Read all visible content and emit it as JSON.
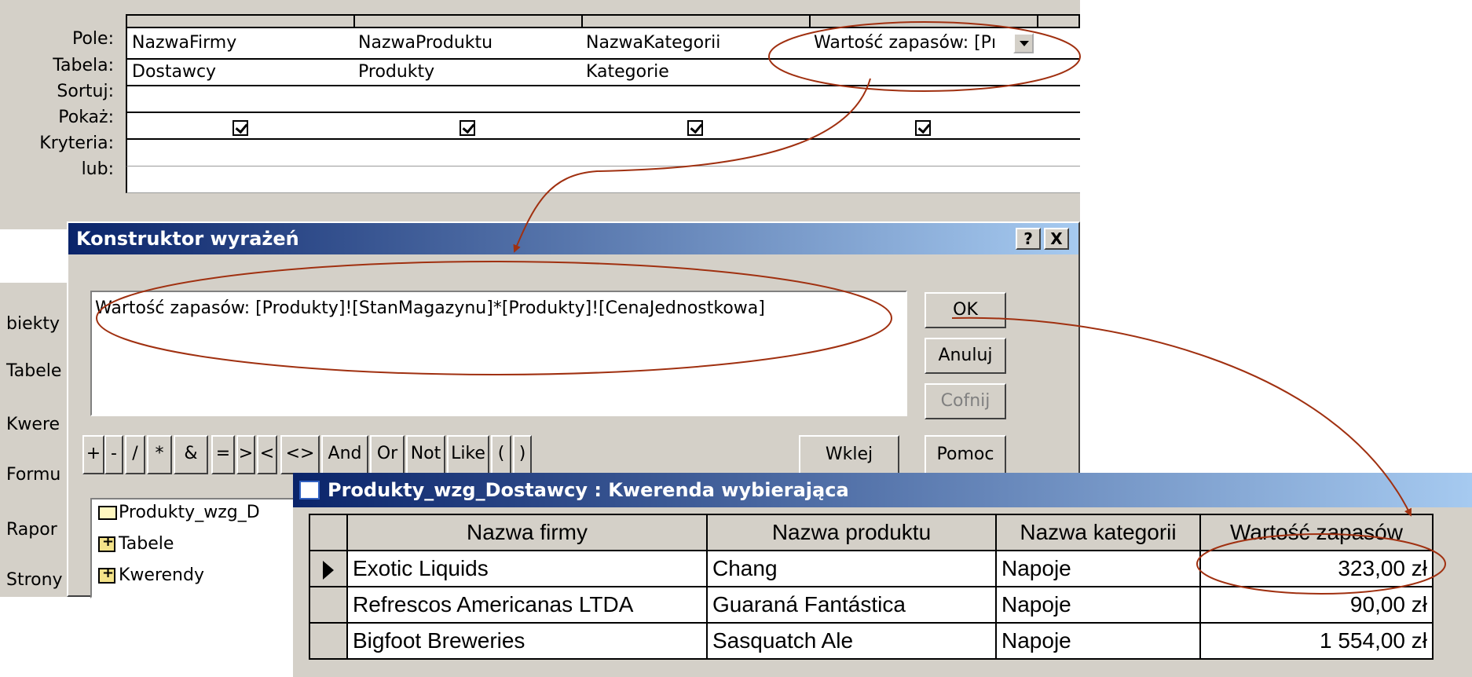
{
  "qbe": {
    "row_labels": [
      "Pole:",
      "Tabela:",
      "Sortuj:",
      "Pokaż:",
      "Kryteria:",
      "lub:"
    ],
    "columns": [
      {
        "field": "NazwaFirmy",
        "table": "Dostawcy",
        "show": true
      },
      {
        "field": "NazwaProduktu",
        "table": "Produkty",
        "show": true
      },
      {
        "field": "NazwaKategorii",
        "table": "Kategorie",
        "show": true
      },
      {
        "field": "Wartość zapasów: [Pı",
        "table": "",
        "show": true
      }
    ]
  },
  "db_window": {
    "items": [
      "biekty",
      "Tabele",
      "Kwere",
      "Formu",
      "Rapor",
      "Strony"
    ]
  },
  "expression_builder": {
    "title": "Konstruktor wyrażeń",
    "help": "?",
    "close": "X",
    "expression": "Wartość zapasów: [Produkty]![StanMagazynu]*[Produkty]![CenaJednostkowa]",
    "buttons": {
      "ok": "OK",
      "cancel": "Anuluj",
      "undo": "Cofnij",
      "paste": "Wklej",
      "help": "Pomoc"
    },
    "operators": [
      "+",
      "-",
      "/",
      "*",
      "&",
      "=",
      ">",
      "<",
      "<>",
      "And",
      "Or",
      "Not",
      "Like",
      "(",
      ")"
    ],
    "tree": [
      "Produkty_wzg_D",
      "Tabele",
      "Kwerendy"
    ]
  },
  "datasheet": {
    "title": "Produkty_wzg_Dostawcy : Kwerenda wybierająca",
    "headers": [
      "Nazwa firmy",
      "Nazwa produktu",
      "Nazwa kategorii",
      "Wartość zapasów"
    ],
    "rows": [
      [
        "Exotic Liquids",
        "Chang",
        "Napoje",
        "323,00 zł"
      ],
      [
        "Refrescos Americanas LTDA",
        "Guaraná Fantástica",
        "Napoje",
        "90,00 zł"
      ],
      [
        "Bigfoot Breweries",
        "Sasquatch Ale",
        "Napoje",
        "1 554,00 zł"
      ]
    ]
  },
  "colors": {
    "annotation": "#a03010",
    "title_bar": "#0a246a",
    "face": "#d4d0c8"
  }
}
